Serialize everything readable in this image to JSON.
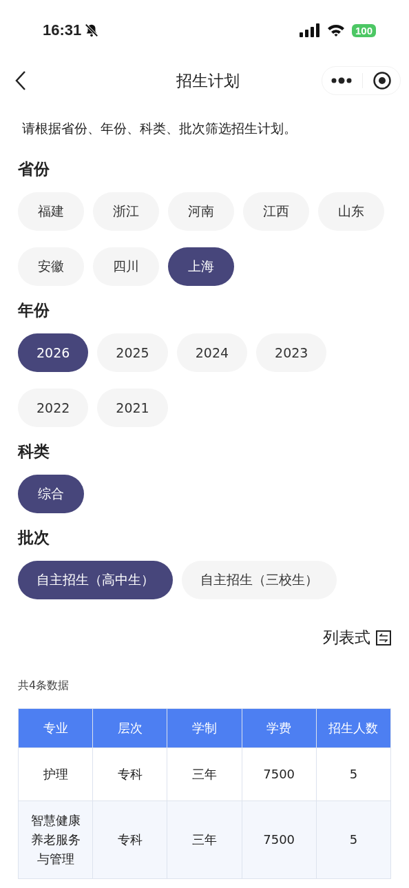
{
  "status_bar": {
    "time": "16:31",
    "muted": true,
    "battery": "100"
  },
  "nav": {
    "title": "招生计划"
  },
  "intro": "请根据省份、年份、科类、批次筛选招生计划。",
  "filters": [
    {
      "title": "省份",
      "options": [
        {
          "label": "福建",
          "selected": false
        },
        {
          "label": "浙江",
          "selected": false
        },
        {
          "label": "河南",
          "selected": false
        },
        {
          "label": "江西",
          "selected": false
        },
        {
          "label": "山东",
          "selected": false
        },
        {
          "label": "安徽",
          "selected": false
        },
        {
          "label": "四川",
          "selected": false
        },
        {
          "label": "上海",
          "selected": true
        }
      ]
    },
    {
      "title": "年份",
      "options": [
        {
          "label": "2026",
          "selected": true
        },
        {
          "label": "2025",
          "selected": false
        },
        {
          "label": "2024",
          "selected": false
        },
        {
          "label": "2023",
          "selected": false
        },
        {
          "label": "2022",
          "selected": false
        },
        {
          "label": "2021",
          "selected": false
        }
      ]
    },
    {
      "title": "科类",
      "options": [
        {
          "label": "综合",
          "selected": true
        }
      ]
    },
    {
      "title": "批次",
      "options": [
        {
          "label": "自主招生（高中生）",
          "selected": true
        },
        {
          "label": "自主招生（三校生）",
          "selected": false
        }
      ]
    }
  ],
  "view_toggle": {
    "label": "列表式"
  },
  "count": "共4条数据",
  "table": {
    "columns": [
      "专业",
      "层次",
      "学制",
      "学费",
      "招生人数"
    ],
    "rows": [
      [
        "护理",
        "专科",
        "三年",
        "7500",
        "5"
      ],
      [
        "智慧健康养老服务与管理",
        "专科",
        "三年",
        "7500",
        "5"
      ]
    ]
  }
}
